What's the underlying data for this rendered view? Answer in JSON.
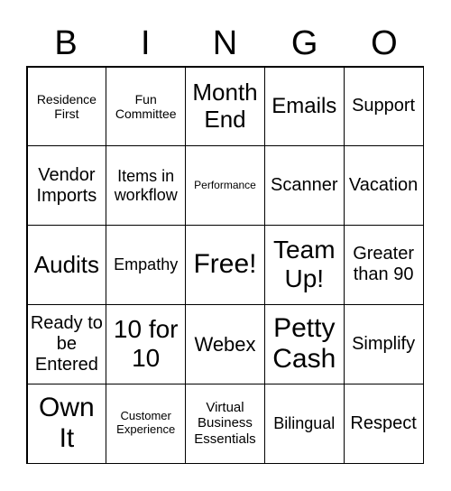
{
  "header": [
    "B",
    "I",
    "N",
    "G",
    "O"
  ],
  "cells": [
    "Residence First",
    "Fun Committee",
    "Month End",
    "Emails",
    "Support",
    "Vendor Imports",
    "Items in workflow",
    "Performance",
    "Scanner",
    "Vacation",
    "Audits",
    "Empathy",
    "Free!",
    "Team Up!",
    "Greater than 90",
    "Ready to be Entered",
    "10 for 10",
    "Webex",
    "Petty Cash",
    "Simplify",
    "Own It",
    "Customer Experience",
    "Virtual Business Essentials",
    "Bilingual",
    "Respect"
  ]
}
